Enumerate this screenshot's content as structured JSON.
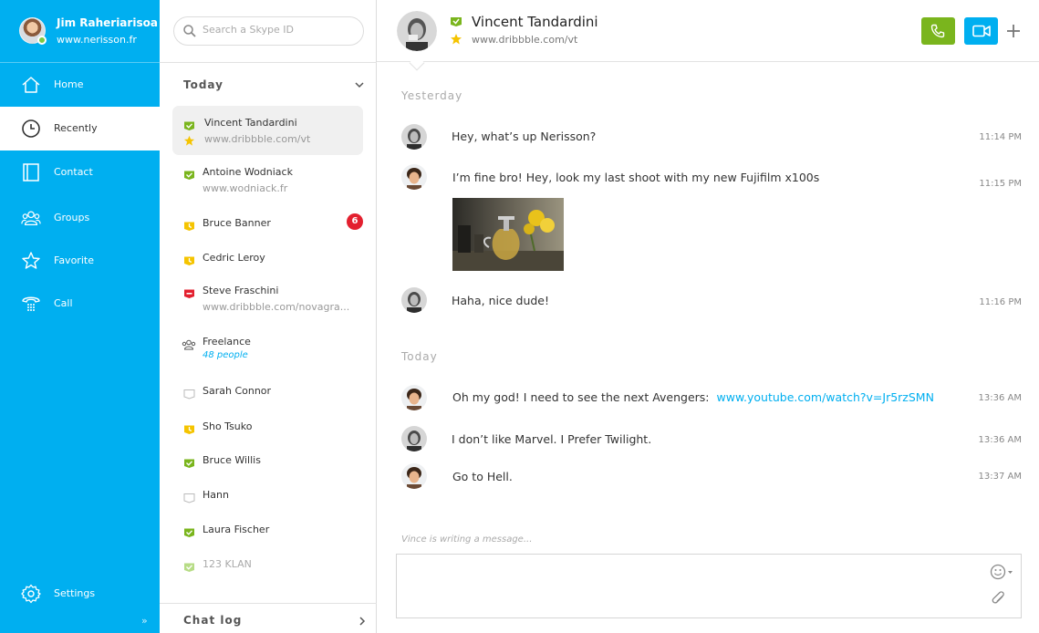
{
  "user": {
    "name": "Jim Raheriarisoa",
    "site": "www.nerisson.fr",
    "status_color": "#7ac943"
  },
  "nav": {
    "items": [
      {
        "label": "Home",
        "icon": "home-icon"
      },
      {
        "label": "Recently",
        "icon": "clock-icon",
        "active": true
      },
      {
        "label": "Contact",
        "icon": "contact-book-icon"
      },
      {
        "label": "Groups",
        "icon": "groups-icon"
      },
      {
        "label": "Favorite",
        "icon": "star-icon"
      },
      {
        "label": "Call",
        "icon": "phone-keypad-icon"
      }
    ],
    "settings_label": "Settings",
    "collapse_glyph": "»"
  },
  "search": {
    "placeholder": "Search a Skype ID"
  },
  "sections": {
    "today": "Today",
    "chat_log": "Chat log"
  },
  "contacts": [
    {
      "name": "Vincent Tandardini",
      "sub": "www.dribbble.com/vt",
      "status": "online",
      "favorite": true,
      "selected": true
    },
    {
      "name": "Antoine Wodniack",
      "sub": "www.wodniack.fr",
      "status": "online"
    },
    {
      "name": "Bruce Banner",
      "status": "away",
      "badge": "6"
    },
    {
      "name": "Cedric Leroy",
      "status": "away"
    },
    {
      "name": "Steve Fraschini",
      "sub": "www.dribbble.com/novagra...",
      "status": "busy"
    },
    {
      "name": "Freelance",
      "sub": "48 people",
      "group": true
    },
    {
      "name": "Sarah Connor",
      "status": "offline"
    },
    {
      "name": "Sho Tsuko",
      "status": "away"
    },
    {
      "name": "Bruce Willis",
      "status": "online"
    },
    {
      "name": "Hann",
      "status": "offline"
    },
    {
      "name": "Laura Fischer",
      "status": "online"
    },
    {
      "name": "123 KLAN",
      "status": "online-faded"
    }
  ],
  "colors": {
    "accent": "#00aff0",
    "online": "#7ab51d",
    "away": "#f5c400",
    "busy": "#e3202f",
    "badge": "#e3202f"
  },
  "chat": {
    "name": "Vincent Tandardini",
    "site": "www.dribbble.com/vt",
    "days": {
      "yesterday": "Yesterday",
      "today": "Today"
    },
    "messages": [
      {
        "from": "vincent",
        "text": "Hey, what’s up Nerisson?",
        "time": "11:14 PM"
      },
      {
        "from": "jim",
        "text": "I’m fine bro! Hey, look my last shoot with my new Fujifilm x100s",
        "time": "11:15 PM",
        "photo": "teapot-photo"
      },
      {
        "from": "vincent",
        "text": "Haha, nice dude!",
        "time": "11:16 PM"
      },
      {
        "from": "jim",
        "text": "Oh my god! I need to see the next Avengers:",
        "link": "www.youtube.com/watch?v=Jr5rzSMN",
        "time": "13:36 AM"
      },
      {
        "from": "vincent",
        "text": "I don’t like Marvel. I Prefer Twilight.",
        "time": "13:36 AM"
      },
      {
        "from": "jim",
        "text": "Go to Hell.",
        "time": "13:37 AM"
      }
    ],
    "typing": "Vince is writing a message...",
    "composer_value": ""
  }
}
